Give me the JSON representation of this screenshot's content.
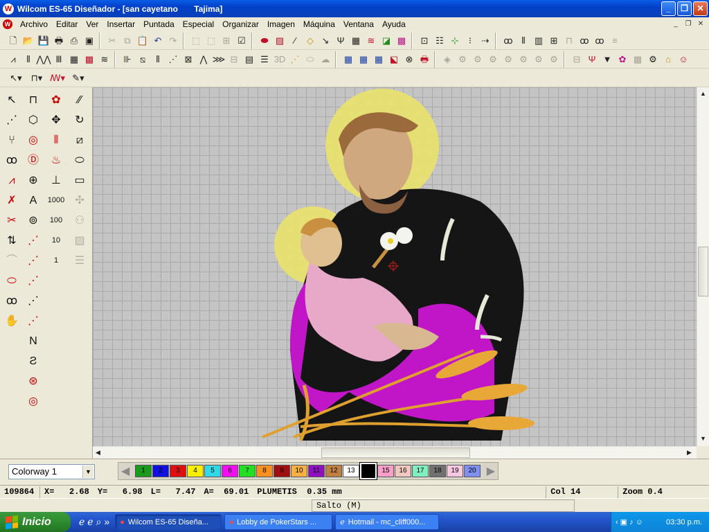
{
  "window": {
    "title": "Wilcom ES-65 Diseñador - [san cayetano       Tajima]"
  },
  "menu": [
    "Archivo",
    "Editar",
    "Ver",
    "Insertar",
    "Puntada",
    "Especial",
    "Organizar",
    "Imagen",
    "Máquina",
    "Ventana",
    "Ayuda"
  ],
  "colorway": {
    "selected": "Colorway 1"
  },
  "palette": {
    "selected_index": 13,
    "swatches": [
      {
        "label": "1",
        "color": "#1a9a1a"
      },
      {
        "label": "2",
        "color": "#1010e0"
      },
      {
        "label": "3",
        "color": "#e01010"
      },
      {
        "label": "4",
        "color": "#f8f000"
      },
      {
        "label": "5",
        "color": "#30d8e8"
      },
      {
        "label": "6",
        "color": "#f010f0"
      },
      {
        "label": "7",
        "color": "#20e020"
      },
      {
        "label": "8",
        "color": "#f89020"
      },
      {
        "label": "9",
        "color": "#a01010"
      },
      {
        "label": "10",
        "color": "#f8b040"
      },
      {
        "label": "11",
        "color": "#9010c0"
      },
      {
        "label": "12",
        "color": "#c08040"
      },
      {
        "label": "13",
        "color": "#ffffff"
      },
      {
        "label": "",
        "color": "#000000"
      },
      {
        "label": "15",
        "color": "#f8a0c8"
      },
      {
        "label": "16",
        "color": "#f0c8c0"
      },
      {
        "label": "17",
        "color": "#80f0c0"
      },
      {
        "label": "18",
        "color": "#707070"
      },
      {
        "label": "19",
        "color": "#f8c8e0"
      },
      {
        "label": "20",
        "color": "#8090f0"
      }
    ]
  },
  "status": {
    "stitches": "109864",
    "x": "X=   2.68",
    "y": "Y=   6.98",
    "l": "L=   7.47",
    "a": "A=  69.01",
    "type": "PLUMETIS  0.35 mm",
    "col": "Col 14",
    "zoom": "Zoom 0.4"
  },
  "prompt": "Salto (M)",
  "taskbar": {
    "start": "Inicio",
    "tasks": [
      "Wilcom ES-65 Diseña...",
      "Lobby de PokerStars ...",
      "Hotmail - mc_cliff000..."
    ],
    "clock": "03:30 p.m."
  }
}
